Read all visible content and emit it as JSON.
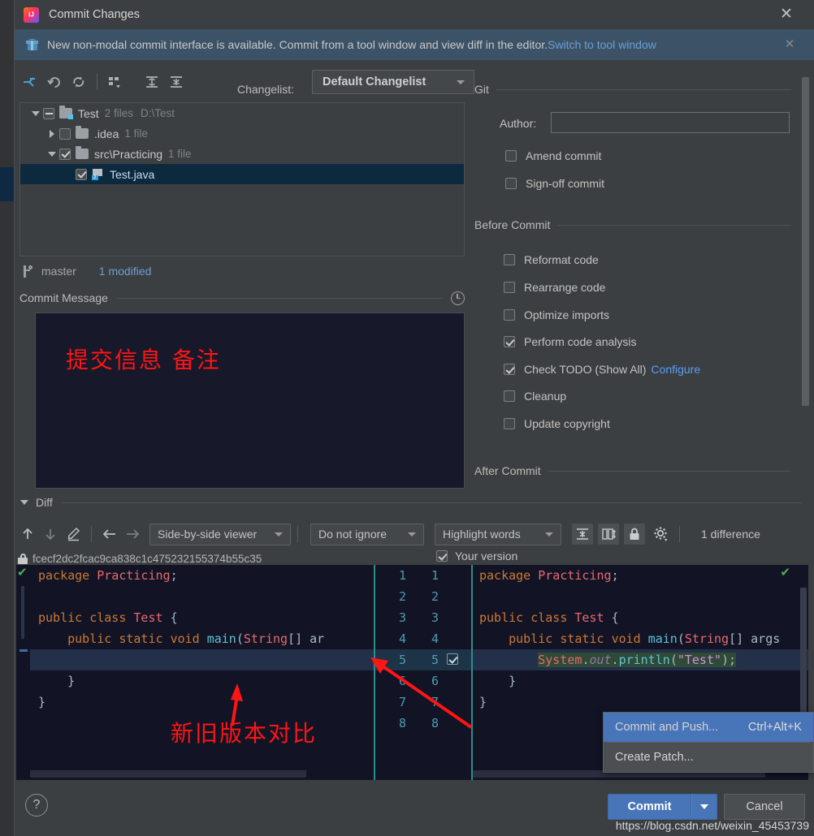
{
  "window": {
    "title": "Commit Changes",
    "close_label": "✕"
  },
  "banner": {
    "icon": "gift-icon",
    "text": "New non-modal commit interface is available. Commit from a tool window and view diff in the editor.",
    "link": "Switch to tool window",
    "close_label": "✕"
  },
  "changelist_toolbar": {
    "icons": [
      "move-to-another-changelist-icon",
      "revert-icon",
      "refresh-icon",
      "group-by-icon",
      "expand-all-icon",
      "collapse-all-icon"
    ],
    "label": "Changelist:",
    "selected": "Default Changelist"
  },
  "tree": {
    "rows": [
      {
        "name": "Test",
        "meta": "2 files",
        "meta2": "D:\\Test",
        "indent": 0,
        "expander": "down",
        "checkbox": "partial",
        "icon": "folder-modified-icon",
        "selected": false
      },
      {
        "name": ".idea",
        "meta": "1 file",
        "meta2": "",
        "indent": 1,
        "expander": "right",
        "checkbox": "unchecked",
        "icon": "folder-icon",
        "selected": false
      },
      {
        "name": "src\\Practicing",
        "meta": "1 file",
        "meta2": "",
        "indent": 1,
        "expander": "down",
        "checkbox": "checked",
        "icon": "folder-icon",
        "selected": false
      },
      {
        "name": "Test.java",
        "meta": "",
        "meta2": "",
        "indent": 2,
        "expander": "none",
        "checkbox": "checked",
        "icon": "java-file-icon",
        "selected": true
      }
    ]
  },
  "branch_bar": {
    "icon": "branch-icon",
    "branch": "master",
    "modified": "1 modified"
  },
  "commit_message": {
    "section_title": "Commit Message",
    "history_icon": "clock-icon",
    "value": "",
    "annotation": "提交信息 备注"
  },
  "git_section": {
    "title": "Git",
    "author_label": "Author:",
    "author_value": "",
    "options": [
      {
        "label": "Amend commit",
        "checked": false
      },
      {
        "label": "Sign-off commit",
        "checked": false
      }
    ]
  },
  "before_commit": {
    "title": "Before Commit",
    "options": [
      {
        "label": "Reformat code",
        "checked": false,
        "link": ""
      },
      {
        "label": "Rearrange code",
        "checked": false,
        "link": ""
      },
      {
        "label": "Optimize imports",
        "checked": false,
        "link": ""
      },
      {
        "label": "Perform code analysis",
        "checked": true,
        "link": ""
      },
      {
        "label": "Check TODO (Show All)",
        "checked": true,
        "link": "Configure"
      },
      {
        "label": "Cleanup",
        "checked": false,
        "link": ""
      },
      {
        "label": "Update copyright",
        "checked": false,
        "link": ""
      }
    ]
  },
  "after_commit": {
    "title": "After Commit"
  },
  "diff": {
    "section_title": "Diff",
    "toolbar": {
      "prev_icon": "arrow-up-icon",
      "next_icon": "arrow-down-icon",
      "edit_icon": "pencil-icon",
      "accept_left_icon": "arrow-left-icon",
      "accept_right_icon": "arrow-right-icon",
      "viewer_mode": "Side-by-side viewer",
      "whitespace_mode": "Do not ignore",
      "highlight_mode": "Highlight words",
      "collapse_icon": "collapse-unchanged-icon",
      "sync_scroll_icon": "sync-scroll-icon",
      "readonly_icon": "lock-icon",
      "settings_icon": "gear-icon",
      "more_icon": "chevron-double-right-icon",
      "difference_count": "1 difference"
    },
    "left_header": {
      "lock_icon": "lock-icon",
      "revision": "fcecf2dc2fcac9ca838c1c475232155374b55c35"
    },
    "right_header": {
      "checked": true,
      "label": "Your version"
    },
    "left_lines": [
      {
        "text": "package Practicing;",
        "kind": "pkg"
      },
      {
        "text": "",
        "kind": "blank"
      },
      {
        "text": "public class Test {",
        "kind": "cls"
      },
      {
        "text": "    public static void main(String[] ar",
        "kind": "main"
      },
      {
        "text": "",
        "kind": "gap"
      },
      {
        "text": "    }",
        "kind": "plain"
      },
      {
        "text": "}",
        "kind": "plain"
      }
    ],
    "line_numbers": [
      {
        "left": "1",
        "right": "1",
        "changed": false
      },
      {
        "left": "2",
        "right": "2",
        "changed": false
      },
      {
        "left": "3",
        "right": "3",
        "changed": false
      },
      {
        "left": "4",
        "right": "4",
        "changed": false
      },
      {
        "left": "5",
        "right": "5",
        "changed": true
      },
      {
        "left": "6",
        "right": "6",
        "changed": false
      },
      {
        "left": "7",
        "right": "7",
        "changed": false
      },
      {
        "left": "8",
        "right": "8",
        "changed": false
      }
    ],
    "right_lines": [
      {
        "text": "package Practicing;",
        "kind": "pkg"
      },
      {
        "text": "",
        "kind": "blank"
      },
      {
        "text": "public class Test {",
        "kind": "cls"
      },
      {
        "text": "    public static void main(String[] args",
        "kind": "main"
      },
      {
        "text": "        System.out.println(\"Test\");",
        "kind": "inserted"
      },
      {
        "text": "    }",
        "kind": "plain"
      },
      {
        "text": "}",
        "kind": "plain"
      }
    ],
    "annotation": "新旧版本对比"
  },
  "menu": {
    "items": [
      {
        "label": "Commit and Push...",
        "shortcut": "Ctrl+Alt+K",
        "highlighted": true
      },
      {
        "label": "Create Patch...",
        "shortcut": "",
        "highlighted": false
      }
    ]
  },
  "bottom": {
    "help_label": "?",
    "commit_label": "Commit",
    "cancel_label": "Cancel"
  },
  "watermark": "https://blog.csdn.net/weixin_45453739",
  "colors": {
    "accent_blue": "#4874b8",
    "link_blue": "#589df6",
    "annotation_red": "#ff1515",
    "banner_bg": "#3c5367",
    "selection_bg": "#0d293e",
    "editor_bg": "#121426",
    "inserted_bg": "#2f4a36"
  }
}
